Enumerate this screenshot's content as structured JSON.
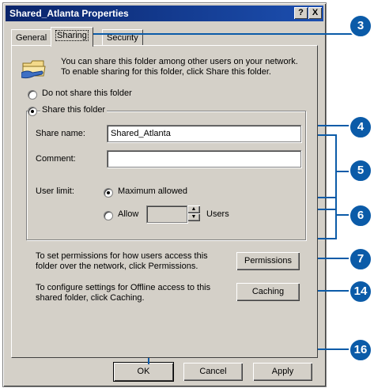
{
  "window": {
    "title": "Shared_Atlanta Properties",
    "help_btn": "?",
    "close_btn": "X"
  },
  "tabs": [
    {
      "label": "General"
    },
    {
      "label": "Sharing",
      "active": true
    },
    {
      "label": "Security"
    }
  ],
  "sharing": {
    "description": "You can share this folder among other users on your network.  To enable sharing for this folder, click Share this folder.",
    "do_not_share": "Do not share this folder",
    "share_this": "Share this folder",
    "selected": "share_this",
    "share_name_label": "Share name:",
    "share_name_value": "Shared_Atlanta",
    "comment_label": "Comment:",
    "comment_value": "",
    "user_limit_label": "User limit:",
    "max_allowed": "Maximum allowed",
    "allow": "Allow",
    "users": "Users",
    "allow_count": "",
    "user_limit_selected": "max_allowed",
    "permissions_text": "To set permissions for how users access this folder over the network, click Permissions.",
    "permissions_button": "Permissions",
    "caching_text": "To configure settings for Offline access to this shared folder, click Caching.",
    "caching_button": "Caching"
  },
  "footer": {
    "ok": "OK",
    "cancel": "Cancel",
    "apply": "Apply"
  },
  "callouts": [
    "3",
    "4",
    "5",
    "6",
    "7",
    "14",
    "16"
  ],
  "colors": {
    "callout": "#0b5ba8",
    "titlebar": "#0a246a",
    "face": "#d4d0c8"
  }
}
